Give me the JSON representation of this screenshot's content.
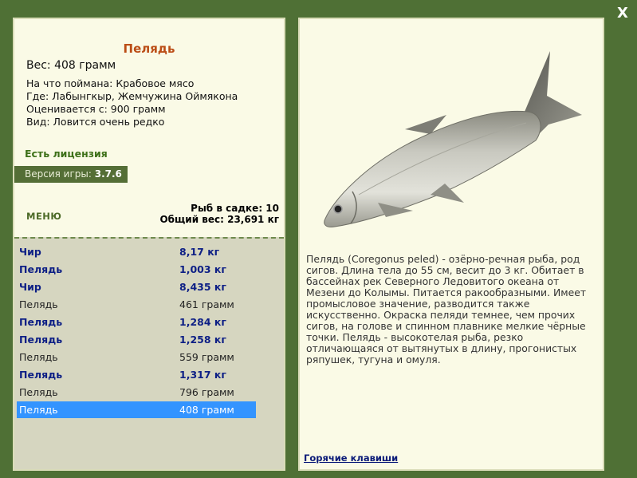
{
  "fish": {
    "name": "Пелядь",
    "weight": "Вес: 408 грамм",
    "bait": "На что поймана: Крабовое мясо",
    "location": "Где: Лабынгкыр, Жемчужина Оймякона",
    "value": "Оценивается с: 900 грамм",
    "rarity": "Вид: Ловится очень редко"
  },
  "license": "Есть лицензия",
  "version": {
    "label": "Версия игры: ",
    "number": "3.7.6"
  },
  "menu_label": "МЕНЮ",
  "stats": {
    "count": "Рыб в садке: 10",
    "total": "Общий вес: 23,691 кг"
  },
  "catch_list": [
    {
      "name": "Чир",
      "weight": "8,17 кг"
    },
    {
      "name": "Пелядь",
      "weight": "1,003 кг"
    },
    {
      "name": "Чир",
      "weight": "8,435 кг"
    },
    {
      "name": "Пелядь",
      "weight": "461 грамм"
    },
    {
      "name": "Пелядь",
      "weight": "1,284 кг"
    },
    {
      "name": "Пелядь",
      "weight": "1,258 кг"
    },
    {
      "name": "Пелядь",
      "weight": "559 грамм"
    },
    {
      "name": "Пелядь",
      "weight": "1,317 кг"
    },
    {
      "name": "Пелядь",
      "weight": "796 грамм"
    },
    {
      "name": "Пелядь",
      "weight": "408 грамм"
    }
  ],
  "description": [
    "Пелядь (Coregonus peled) - озёрно-речная рыба, род",
    "сигов. Длина тела до 55 см, весит до 3 кг. Обитает в",
    "бассейнах рек Северного Ледовитого океана от",
    "Мезени до Колымы. Питается ракообразными. Имеет",
    "промысловое значение, разводится также",
    "искусственно. Окраска пеляди темнее, чем прочих",
    "сигов, на голове и спинном плавнике мелкие чёрные",
    "точки. Пелядь - высокотелая рыба, резко",
    "отличающаяся от вытянутых в длину, прогонистых",
    "ряпушек, тугуна и омуля."
  ],
  "hotkeys": "Горячие клавиши",
  "close": "X",
  "colors": {
    "background": "#4f7035",
    "panel": "#fafae6",
    "fish_name": "#bb4d16",
    "license": "#3d7018",
    "selected_row": "#3394ff",
    "bold_row": "#0d1f85"
  }
}
